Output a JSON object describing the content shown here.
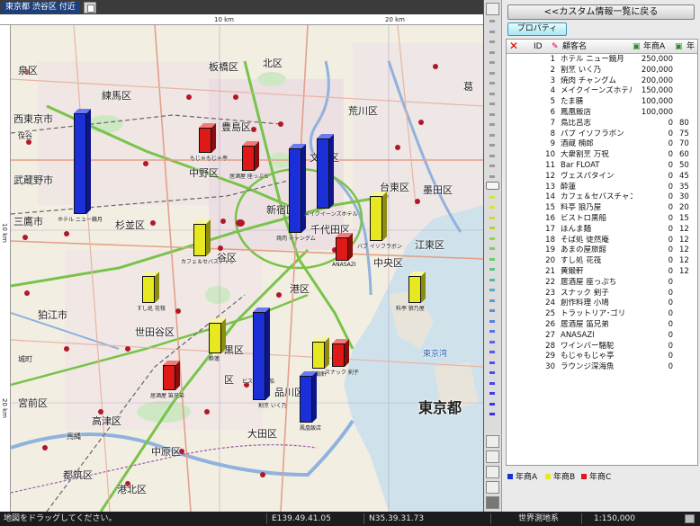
{
  "map": {
    "title": "東京都 渋谷区 付近",
    "ruler_top": [
      "10 km",
      "20 km"
    ],
    "ruler_left": [
      "10 km",
      "20 km"
    ],
    "wards": [
      "板橋区",
      "北区",
      "練馬区",
      "荒川区",
      "豊島区",
      "葛",
      "中野区",
      "文京区",
      "台東区",
      "墨田区",
      "杉並区",
      "新宿区",
      "千代田区",
      "江東区",
      "谷区",
      "中央区",
      "狛江市",
      "港区",
      "世田谷区",
      "黒区",
      "品川区",
      "区",
      "大田区",
      "宮前区",
      "高津区",
      "中原区",
      "都筑区",
      "港北区",
      "東京都",
      "三鷹市",
      "武蔵野市",
      "西東京市",
      "保谷",
      "泉区",
      "城町",
      "馬縄",
      "東京湾"
    ],
    "bar_labels": [
      "ホテル ニュー鏡月",
      "もじゃもじゃ亭",
      "居酒屋 座っぷち",
      "焼肉 チャングム",
      "メイクイーンズホテル",
      "バブ イソフラボン",
      "カフェ＆セバスチャン",
      "ANASAZI",
      "すし処 花筏",
      "料亭 狼乃屋",
      "酔蓮",
      "ビストロ黒船",
      "割烹 いく乃",
      "黄鍛軒",
      "スナック 剣子",
      "居酒屋 笛兄弟",
      "鳳凰飯店"
    ]
  },
  "panel": {
    "back_button": "<<カスタム情報一覧に戻る",
    "property_button": "プロパティ",
    "columns": {
      "id": "ID",
      "name": "顧客名",
      "a": "年商A",
      "b": "年"
    },
    "rows": [
      {
        "id": "1",
        "name": "ホテル ニュー鏡月",
        "a": "250,000",
        "b": ""
      },
      {
        "id": "2",
        "name": "割烹 いく乃",
        "a": "200,000",
        "b": ""
      },
      {
        "id": "3",
        "name": "焼肉 チャングム",
        "a": "200,000",
        "b": ""
      },
      {
        "id": "4",
        "name": "メイクイーンズホテル",
        "a": "150,000",
        "b": ""
      },
      {
        "id": "5",
        "name": "たま膳",
        "a": "100,000",
        "b": ""
      },
      {
        "id": "6",
        "name": "鳳凰飯店",
        "a": "100,000",
        "b": ""
      },
      {
        "id": "7",
        "name": "鳥比呂志",
        "a": "0",
        "b": "80"
      },
      {
        "id": "8",
        "name": "パブ イソフラボン",
        "a": "0",
        "b": "75"
      },
      {
        "id": "9",
        "name": "酒蔵 楠郎",
        "a": "0",
        "b": "70"
      },
      {
        "id": "10",
        "name": "大衆割烹 万祝",
        "a": "0",
        "b": "60"
      },
      {
        "id": "11",
        "name": "Bar FLOAT",
        "a": "0",
        "b": "50"
      },
      {
        "id": "12",
        "name": "ヴェスパタイン",
        "a": "0",
        "b": "45"
      },
      {
        "id": "13",
        "name": "酔蓮",
        "a": "0",
        "b": "35"
      },
      {
        "id": "14",
        "name": "カフェ＆セバスチャン",
        "a": "0",
        "b": "30"
      },
      {
        "id": "15",
        "name": "料亭 狼乃屋",
        "a": "0",
        "b": "20"
      },
      {
        "id": "16",
        "name": "ビストロ黒船",
        "a": "0",
        "b": "15"
      },
      {
        "id": "17",
        "name": "ほんま麺",
        "a": "0",
        "b": "12"
      },
      {
        "id": "18",
        "name": "そば処 徒然庵",
        "a": "0",
        "b": "12"
      },
      {
        "id": "19",
        "name": "あまの屋旅館",
        "a": "0",
        "b": "12"
      },
      {
        "id": "20",
        "name": "すし処 花筏",
        "a": "0",
        "b": "12"
      },
      {
        "id": "21",
        "name": "黄鍛軒",
        "a": "0",
        "b": "12"
      },
      {
        "id": "22",
        "name": "居酒屋 座っぷち",
        "a": "0",
        "b": ""
      },
      {
        "id": "23",
        "name": "スナック 剣子",
        "a": "0",
        "b": ""
      },
      {
        "id": "24",
        "name": "創作料理 小鳩",
        "a": "0",
        "b": ""
      },
      {
        "id": "25",
        "name": "トラットリア･ゴリ",
        "a": "0",
        "b": ""
      },
      {
        "id": "26",
        "name": "居酒屋 笛兄弟",
        "a": "0",
        "b": ""
      },
      {
        "id": "27",
        "name": "ANASAZI",
        "a": "0",
        "b": ""
      },
      {
        "id": "28",
        "name": "ワインバー駱駝",
        "a": "0",
        "b": ""
      },
      {
        "id": "29",
        "name": "もじゃもじゃ亭",
        "a": "0",
        "b": ""
      },
      {
        "id": "30",
        "name": "ラウンジ深海魚",
        "a": "0",
        "b": ""
      }
    ],
    "legend": [
      {
        "label": "年商A",
        "color": "#1a2fd8"
      },
      {
        "label": "年商B",
        "color": "#e8e820"
      },
      {
        "label": "年商C",
        "color": "#e01818"
      }
    ]
  },
  "status": {
    "hint": "地図をドラッグしてください。",
    "lon": "E139.49.41.05",
    "lat": "N35.39.31.73",
    "datum": "世界測地系",
    "scale": "1:150,000"
  }
}
